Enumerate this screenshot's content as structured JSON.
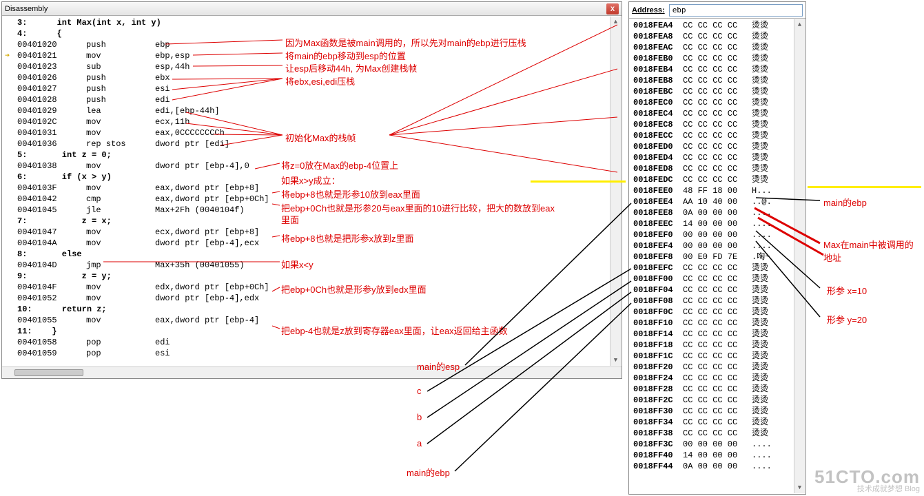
{
  "disasm": {
    "title": "Disassembly",
    "close": "X",
    "lines": [
      {
        "src": true,
        "text": "3:      int Max(int x, int y)"
      },
      {
        "src": true,
        "text": "4:      {"
      },
      {
        "addr": "00401020",
        "op": "push",
        "args": "ebp"
      },
      {
        "arrow": true,
        "addr": "00401021",
        "op": "mov",
        "args": "ebp,esp"
      },
      {
        "addr": "00401023",
        "op": "sub",
        "args": "esp,44h"
      },
      {
        "addr": "00401026",
        "op": "push",
        "args": "ebx"
      },
      {
        "addr": "00401027",
        "op": "push",
        "args": "esi"
      },
      {
        "addr": "00401028",
        "op": "push",
        "args": "edi"
      },
      {
        "addr": "00401029",
        "op": "lea",
        "args": "edi,[ebp-44h]"
      },
      {
        "addr": "0040102C",
        "op": "mov",
        "args": "ecx,11h"
      },
      {
        "addr": "00401031",
        "op": "mov",
        "args": "eax,0CCCCCCCCh"
      },
      {
        "addr": "00401036",
        "op": "rep stos",
        "args": "dword ptr [edi]"
      },
      {
        "src": true,
        "text": "5:       int z = 0;"
      },
      {
        "addr": "00401038",
        "op": "mov",
        "args": "dword ptr [ebp-4],0"
      },
      {
        "src": true,
        "text": "6:       if (x > y)"
      },
      {
        "addr": "0040103F",
        "op": "mov",
        "args": "eax,dword ptr [ebp+8]"
      },
      {
        "addr": "00401042",
        "op": "cmp",
        "args": "eax,dword ptr [ebp+0Ch]"
      },
      {
        "addr": "00401045",
        "op": "jle",
        "args": "Max+2Fh (0040104f)"
      },
      {
        "src": true,
        "text": "7:           z = x;"
      },
      {
        "addr": "00401047",
        "op": "mov",
        "args": "ecx,dword ptr [ebp+8]"
      },
      {
        "addr": "0040104A",
        "op": "mov",
        "args": "dword ptr [ebp-4],ecx"
      },
      {
        "src": true,
        "text": "8:       else"
      },
      {
        "addr": "0040104D",
        "op": "jmp",
        "args": "Max+35h (00401055)"
      },
      {
        "src": true,
        "text": "9:           z = y;"
      },
      {
        "addr": "0040104F",
        "op": "mov",
        "args": "edx,dword ptr [ebp+0Ch]"
      },
      {
        "addr": "00401052",
        "op": "mov",
        "args": "dword ptr [ebp-4],edx"
      },
      {
        "src": true,
        "text": "10:      return z;"
      },
      {
        "addr": "00401055",
        "op": "mov",
        "args": "eax,dword ptr [ebp-4]"
      },
      {
        "src": true,
        "text": "11:    }"
      },
      {
        "addr": "00401058",
        "op": "pop",
        "args": "edi"
      },
      {
        "addr": "00401059",
        "op": "pop",
        "args": "esi"
      }
    ]
  },
  "annotations": {
    "a1": "因为Max函数是被main调用的，所以先对main的ebp进行压栈",
    "a2": "将main的ebp移动到esp的位置",
    "a3": "让esp后移动44h, 为Max创建栈帧",
    "a4": "将ebx,esi,edi压栈",
    "a5": "初始化Max的栈帧",
    "a6": "将z=0放在Max的ebp-4位置上",
    "a7": "如果x>y成立：",
    "a8": "将ebp+8也就是形参10放到eax里面",
    "a9": "把ebp+0Ch也就是形参20与eax里面的10进行比较，把大的数放到eax",
    "a9b": "里面",
    "a10": "将ebp+8也就是把形参x放到z里面",
    "a11": "如果x<y",
    "a12": "把ebp+0Ch也就是形参y放到edx里面",
    "a13": "把ebp-4也就是z放到寄存器eax里面，让eax返回给主函数",
    "main_esp": "main的esp",
    "c": "c",
    "b": "b",
    "a": "a",
    "main_ebp": "main的ebp"
  },
  "memory": {
    "address_label": "Address:",
    "address_value": "ebp",
    "rows": [
      {
        "a": "0018FEA4",
        "b": "CC CC CC CC",
        "s": "烫烫"
      },
      {
        "a": "0018FEA8",
        "b": "CC CC CC CC",
        "s": "烫烫"
      },
      {
        "a": "0018FEAC",
        "b": "CC CC CC CC",
        "s": "烫烫"
      },
      {
        "a": "0018FEB0",
        "b": "CC CC CC CC",
        "s": "烫烫"
      },
      {
        "a": "0018FEB4",
        "b": "CC CC CC CC",
        "s": "烫烫"
      },
      {
        "a": "0018FEB8",
        "b": "CC CC CC CC",
        "s": "烫烫"
      },
      {
        "a": "0018FEBC",
        "b": "CC CC CC CC",
        "s": "烫烫"
      },
      {
        "a": "0018FEC0",
        "b": "CC CC CC CC",
        "s": "烫烫"
      },
      {
        "a": "0018FEC4",
        "b": "CC CC CC CC",
        "s": "烫烫"
      },
      {
        "a": "0018FEC8",
        "b": "CC CC CC CC",
        "s": "烫烫"
      },
      {
        "a": "0018FECC",
        "b": "CC CC CC CC",
        "s": "烫烫"
      },
      {
        "a": "0018FED0",
        "b": "CC CC CC CC",
        "s": "烫烫"
      },
      {
        "a": "0018FED4",
        "b": "CC CC CC CC",
        "s": "烫烫"
      },
      {
        "a": "0018FED8",
        "b": "CC CC CC CC",
        "s": "烫烫"
      },
      {
        "a": "0018FEDC",
        "b": "CC CC CC CC",
        "s": "烫烫"
      },
      {
        "a": "0018FEE0",
        "b": "48 FF 18 00",
        "s": "H..."
      },
      {
        "a": "0018FEE4",
        "b": "AA 10 40 00",
        "s": "..@."
      },
      {
        "a": "0018FEE8",
        "b": "0A 00 00 00",
        "s": "...."
      },
      {
        "a": "0018FEEC",
        "b": "14 00 00 00",
        "s": "...."
      },
      {
        "a": "0018FEF0",
        "b": "00 00 00 00",
        "s": "...."
      },
      {
        "a": "0018FEF4",
        "b": "00 00 00 00",
        "s": "...."
      },
      {
        "a": "0018FEF8",
        "b": "00 E0 FD 7E",
        "s": ".啕~"
      },
      {
        "a": "0018FEFC",
        "b": "CC CC CC CC",
        "s": "烫烫"
      },
      {
        "a": "0018FF00",
        "b": "CC CC CC CC",
        "s": "烫烫"
      },
      {
        "a": "0018FF04",
        "b": "CC CC CC CC",
        "s": "烫烫"
      },
      {
        "a": "0018FF08",
        "b": "CC CC CC CC",
        "s": "烫烫"
      },
      {
        "a": "0018FF0C",
        "b": "CC CC CC CC",
        "s": "烫烫"
      },
      {
        "a": "0018FF10",
        "b": "CC CC CC CC",
        "s": "烫烫"
      },
      {
        "a": "0018FF14",
        "b": "CC CC CC CC",
        "s": "烫烫"
      },
      {
        "a": "0018FF18",
        "b": "CC CC CC CC",
        "s": "烫烫"
      },
      {
        "a": "0018FF1C",
        "b": "CC CC CC CC",
        "s": "烫烫"
      },
      {
        "a": "0018FF20",
        "b": "CC CC CC CC",
        "s": "烫烫"
      },
      {
        "a": "0018FF24",
        "b": "CC CC CC CC",
        "s": "烫烫"
      },
      {
        "a": "0018FF28",
        "b": "CC CC CC CC",
        "s": "烫烫"
      },
      {
        "a": "0018FF2C",
        "b": "CC CC CC CC",
        "s": "烫烫"
      },
      {
        "a": "0018FF30",
        "b": "CC CC CC CC",
        "s": "烫烫"
      },
      {
        "a": "0018FF34",
        "b": "CC CC CC CC",
        "s": "烫烫"
      },
      {
        "a": "0018FF38",
        "b": "CC CC CC CC",
        "s": "烫烫"
      },
      {
        "a": "0018FF3C",
        "b": "00 00 00 00",
        "s": "...."
      },
      {
        "a": "0018FF40",
        "b": "14 00 00 00",
        "s": "...."
      },
      {
        "a": "0018FF44",
        "b": "0A 00 00 00",
        "s": "...."
      }
    ]
  },
  "side": {
    "main_ebp": "main的ebp",
    "max_addr": "Max在main中被调用的地址",
    "x10": "形参 x=10",
    "y20": "形参 y=20"
  },
  "watermark": {
    "big": "51CTO.com",
    "sm": "技术成就梦想 Blog"
  }
}
